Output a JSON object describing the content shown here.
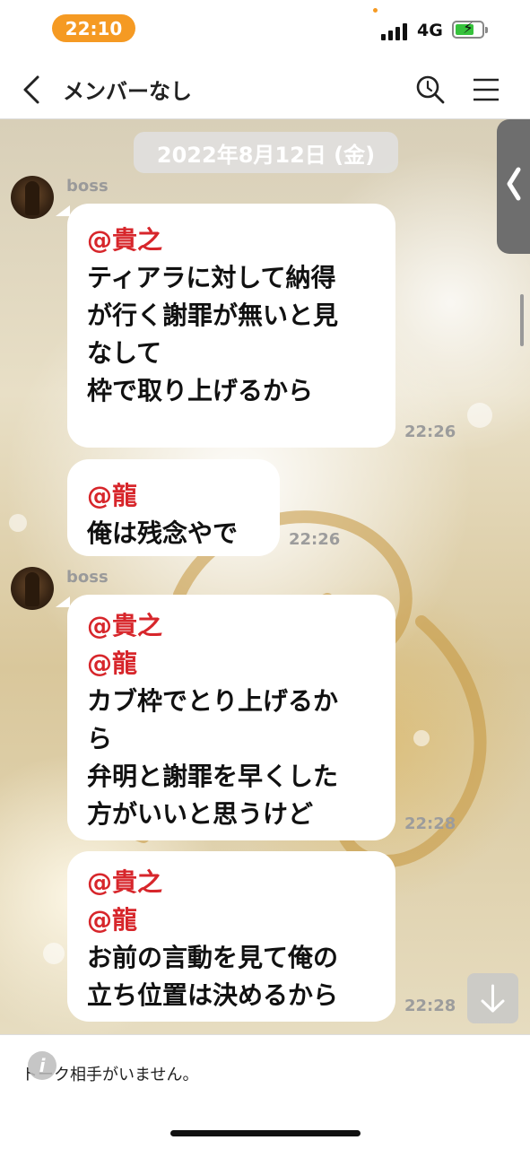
{
  "status_bar": {
    "time": "22:10",
    "network": "4G",
    "battery_charging": true
  },
  "header": {
    "title": "メンバーなし"
  },
  "chat": {
    "date": "2022年8月12日 (金)",
    "messages": [
      {
        "sender": "boss",
        "mentions": [
          "@貴之"
        ],
        "text": "ティアラに対して納得\nが行く謝罪が無いと見\nなして\n枠で取り上げるから",
        "time": "22:26"
      },
      {
        "sender": "",
        "mentions": [
          "@龍"
        ],
        "text": "俺は残念やで",
        "time": "22:26"
      },
      {
        "sender": "boss",
        "mentions": [
          "@貴之",
          "@龍"
        ],
        "text": "カブ枠でとり上げるか\nら\n弁明と謝罪を早くした\n方がいいと思うけど",
        "time": "22:28"
      },
      {
        "sender": "",
        "mentions": [
          "@貴之",
          "@龍"
        ],
        "text": "お前の言動を見て俺の\n立ち位置は決めるから",
        "time": "22:28"
      }
    ]
  },
  "footer": {
    "message": "トーク相手がいません。"
  },
  "colors": {
    "accent": "#f59a23",
    "mention": "#d7262b"
  }
}
